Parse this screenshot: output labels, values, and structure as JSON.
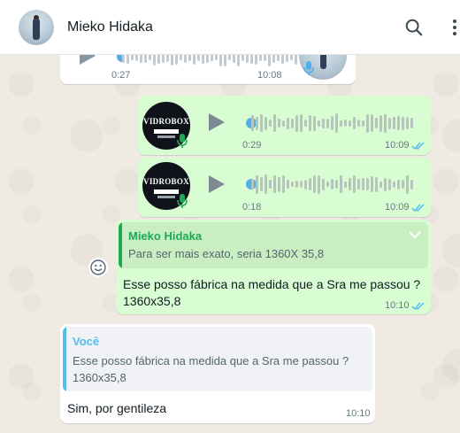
{
  "contact": {
    "name": "Mieko Hidaka"
  },
  "icons": {
    "search": "search-icon",
    "menu": "menu-icon",
    "play": "play-icon",
    "mic": "mic-icon",
    "ticks": "double-check-icon",
    "emoji": "emoji-icon",
    "chevron": "chevron-down-icon"
  },
  "colors": {
    "accent_green": "#1fa855",
    "reply_blue": "#53bdeb",
    "read_ticks": "#53bdeb",
    "out_bubble": "#d9fdd3"
  },
  "messages": [
    {
      "type": "voice",
      "direction": "in",
      "duration": "0:27",
      "time": "10:08"
    },
    {
      "type": "voice",
      "direction": "out",
      "duration": "0:29",
      "time": "10:09",
      "logo_text": "VIDROBOX"
    },
    {
      "type": "voice",
      "direction": "out",
      "duration": "0:18",
      "time": "10:09",
      "logo_text": "VIDROBOX"
    },
    {
      "type": "text",
      "direction": "out",
      "time": "10:10",
      "reply_to": {
        "name": "Mieko Hidaka",
        "text": "Para ser mais exato, seria 1360X 35,8"
      },
      "text_line1": "Esse posso fábrica na medida que a Sra me passou ?",
      "text_line2": "1360x35,8"
    },
    {
      "type": "text",
      "direction": "in",
      "time": "10:10",
      "reply_to": {
        "name": "Você",
        "text_line1": "Esse posso fábrica na medida que a Sra me passou ?",
        "text_line2": "1360x35,8"
      },
      "text": "Sim, por gentileza"
    }
  ]
}
